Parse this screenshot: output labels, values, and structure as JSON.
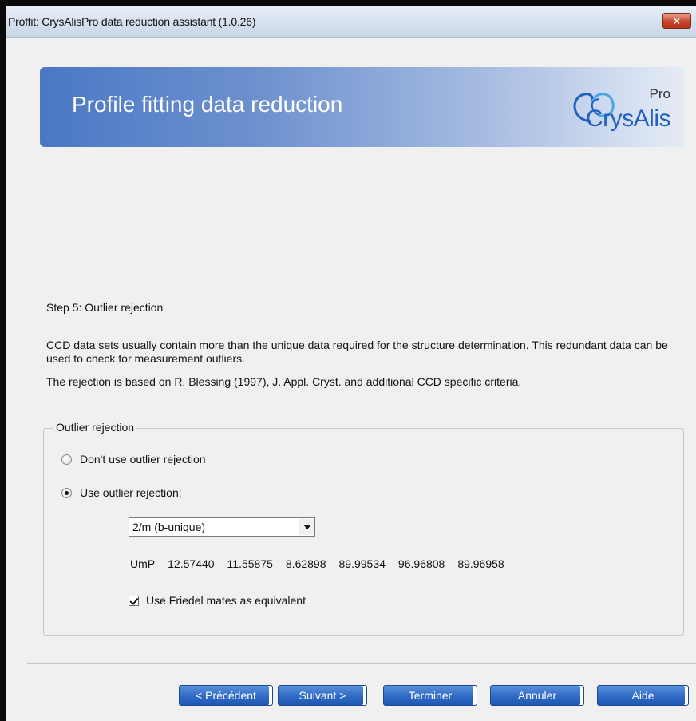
{
  "window": {
    "title": "Proffit: CrysAlisPro data reduction assistant (1.0.26)",
    "close_label": "×"
  },
  "header": {
    "title": "Profile fitting data reduction",
    "logo_top": "Pro",
    "logo_text": "CrysAlis"
  },
  "step": {
    "title": "Step 5: Outlier rejection",
    "description": "CCD data sets usually contain more than the unique data required for the structure determination. This redundant data can be used to check for measurement outliers.",
    "note": "The rejection is based on R. Blessing (1997), J. Appl. Cryst. and additional CCD specific  criteria."
  },
  "outlier_group": {
    "legend": "Outlier rejection",
    "option_none": "Don't use outlier rejection",
    "option_use": "Use outlier rejection:",
    "selected_option": "use",
    "laue_class": "2/m (b-unique)",
    "ump_label": "UmP",
    "ump_values": [
      "12.57440",
      "11.55875",
      "8.62898",
      "89.99534",
      "96.96808",
      "89.96958"
    ],
    "friedel_label": "Use Friedel mates as equivalent",
    "friedel_checked": true
  },
  "buttons": {
    "previous": "< Précédent",
    "next": "Suivant >",
    "finish": "Terminer",
    "cancel": "Annuler",
    "help": "Aide"
  },
  "colors": {
    "accent": "#2f6bc6",
    "banner_start": "#4a78c5"
  }
}
